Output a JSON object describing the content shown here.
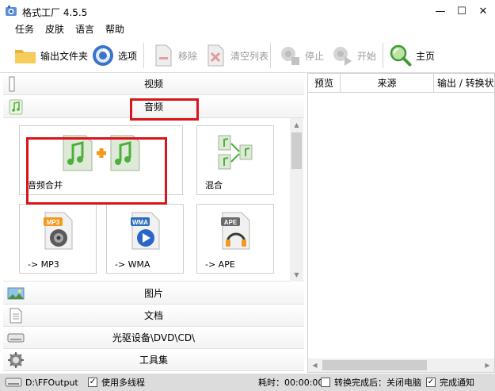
{
  "window": {
    "title": "格式工厂 4.5.5",
    "min": "—",
    "max": "☐",
    "close": "✕"
  },
  "menu": [
    "任务",
    "皮肤",
    "语言",
    "帮助"
  ],
  "toolbar": {
    "output_folder": "输出文件夹",
    "options": "选项",
    "remove": "移除",
    "clear_list": "清空列表",
    "stop": "停止",
    "start": "开始",
    "home": "主页"
  },
  "categories": {
    "video": "视频",
    "audio": "音频",
    "picture": "图片",
    "document": "文档",
    "optical": "光驱设备\\DVD\\CD\\",
    "tools": "工具集"
  },
  "audio_tiles": {
    "merge": "音频合并",
    "mix": "混合",
    "mp3": "-> MP3",
    "wma": "-> WMA",
    "ape": "-> APE",
    "mp3_badge": "MP3",
    "wma_badge": "WMA",
    "ape_badge": "APE"
  },
  "task_list": {
    "col_preview": "预览",
    "col_source": "来源",
    "col_output": "输出 / 转换状态"
  },
  "status": {
    "output_path": "D:\\FFOutput",
    "multithread": "使用多线程",
    "elapsed": "耗时：00:00:00",
    "after_done": "转换完成后：关闭电脑",
    "notify": "完成通知"
  },
  "colors": {
    "highlight": "#d9141a",
    "note_green": "#4bb13a",
    "plus_orange": "#f39a1e"
  }
}
